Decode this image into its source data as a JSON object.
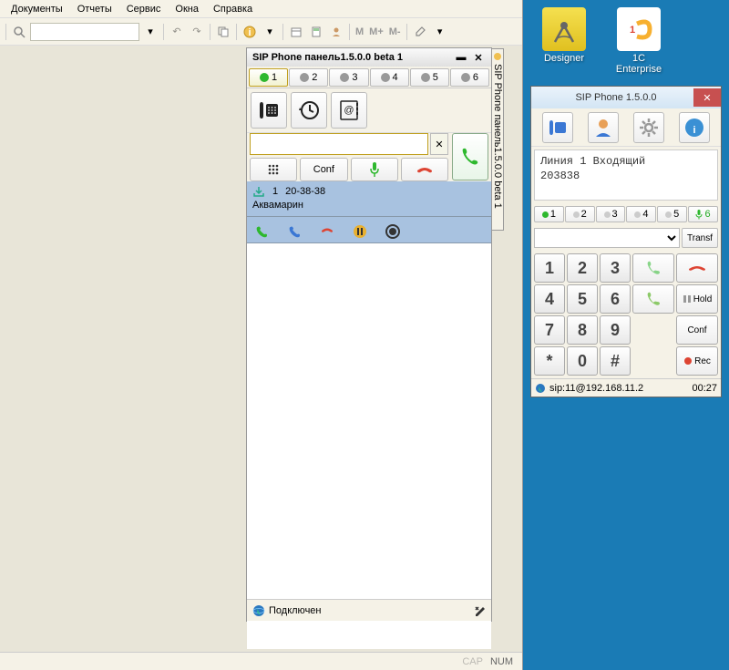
{
  "menu": {
    "items": [
      "Документы",
      "Отчеты",
      "Сервис",
      "Окна",
      "Справка"
    ]
  },
  "toolbar_labels": {
    "m1": "M",
    "m2": "M+",
    "m3": "M-"
  },
  "panel": {
    "title": "SIP Phone панель1.5.0.0 beta 1",
    "side_tab": "SIP Phone панель1.5.0.0 beta 1",
    "lines": [
      "1",
      "2",
      "3",
      "4",
      "5",
      "6"
    ],
    "conf": "Conf",
    "call_item": {
      "num": "1",
      "time": "20-38-38",
      "name": "Аквамарин"
    },
    "status": "Подключен"
  },
  "main_status": {
    "cap": "CAP",
    "num": "NUM"
  },
  "desktop": {
    "designer": "Designer",
    "enterprise": "1C Enterprise"
  },
  "sip": {
    "title": "SIP Phone 1.5.0.0",
    "info_line": "Линия 1 Входящий",
    "info_number": "203838",
    "lines": [
      "1",
      "2",
      "3",
      "4",
      "5",
      "6"
    ],
    "transf": "Transf",
    "keys": [
      "1",
      "2",
      "3",
      "4",
      "5",
      "6",
      "7",
      "8",
      "9",
      "*",
      "0",
      "#"
    ],
    "hold": "Hold",
    "conf": "Conf",
    "rec": "Rec",
    "status_addr": "sip:11@192.168.11.2",
    "status_time": "00:27"
  }
}
